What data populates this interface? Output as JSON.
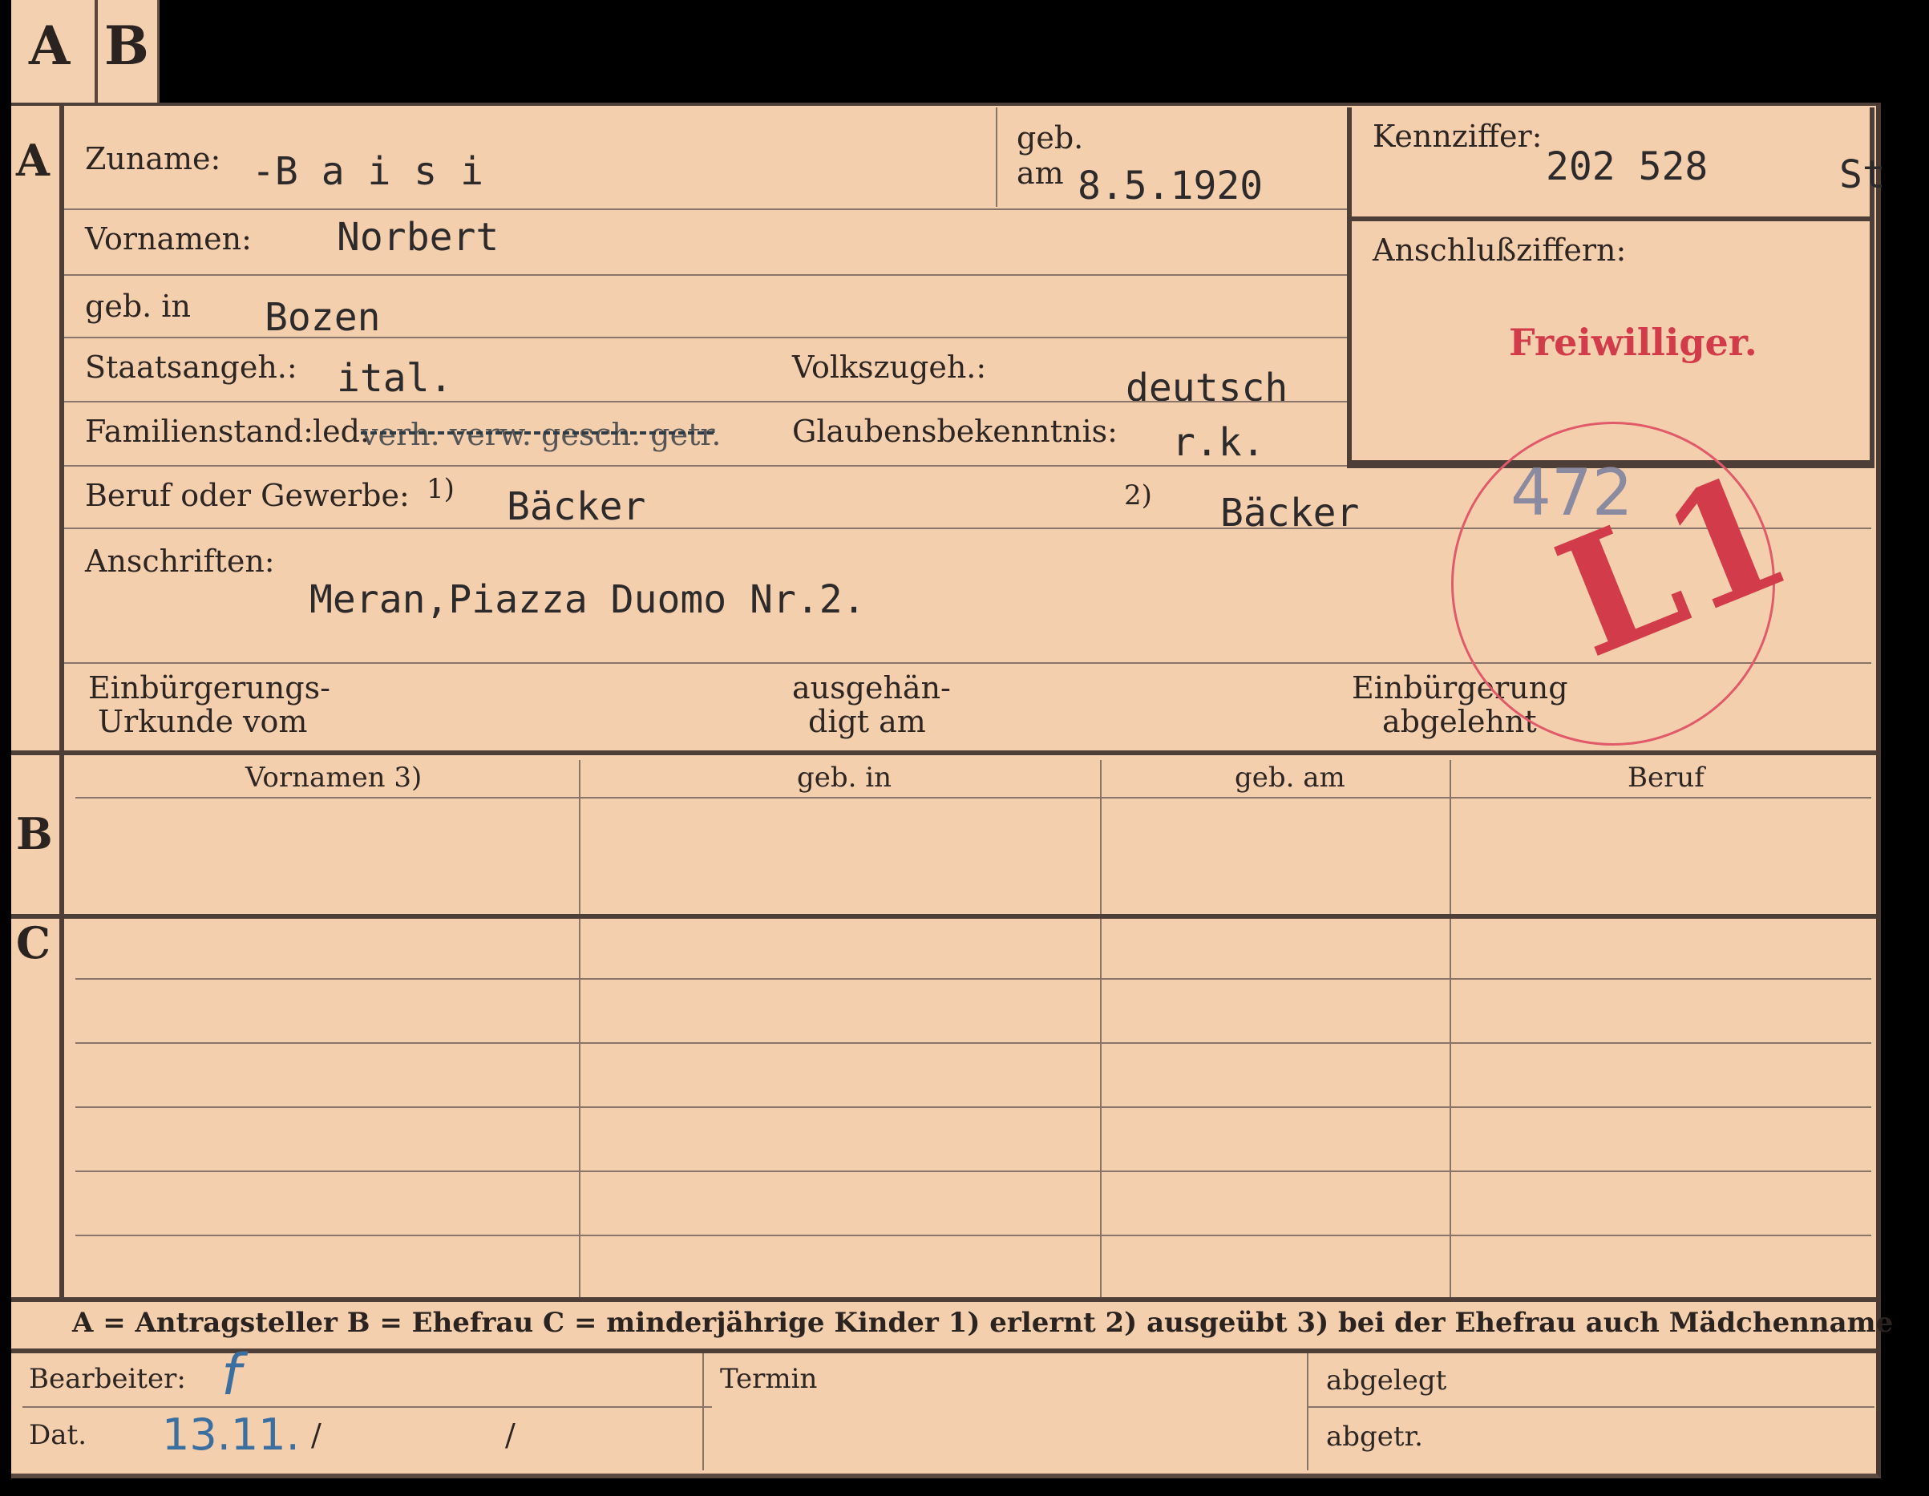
{
  "tabs": [
    "A",
    "B"
  ],
  "sections": {
    "a": "A",
    "b": "B",
    "c": "C"
  },
  "header": {
    "surname_label": "Zuname:",
    "surname": "-B a i s i",
    "born_label": "geb.",
    "born_on_label": "am",
    "birth_date": "8.5.1920",
    "id_label": "Kennziffer:",
    "id_value": "202 528",
    "id_suffix": "St",
    "connection_label": "Anschlußziffern:",
    "volunteer_stamp": "Freiwilliger."
  },
  "fields": {
    "first_names_label": "Vornamen:",
    "first_names": "Norbert",
    "birthplace_label": "geb. in",
    "birthplace": "Bozen",
    "citizenship_label": "Staatsangeh.:",
    "citizenship": "ital.",
    "ethnicity_label": "Volkszugeh.:",
    "ethnicity": "deutsch",
    "marital_label": "Familienstand:",
    "marital_value": "led.",
    "marital_struck": "verh. verw. gesch. getr.",
    "religion_label": "Glaubensbekenntnis:",
    "religion": "r.k.",
    "profession_label": "Beruf oder Gewerbe:",
    "profession_mark_1": "1)",
    "profession_1": "Bäcker",
    "profession_mark_2": "2)",
    "profession_2": "Bäcker",
    "address_label": "Anschriften:",
    "address": "Meran,Piazza  Duomo Nr.2.",
    "naturalization_label_1": "Einbürgerungs-",
    "naturalization_label_2": "Urkunde vom",
    "handed_label_1": "ausgehän-",
    "handed_label_2": "digt am",
    "rejected_label_1": "Einbürgerung",
    "rejected_label_2": "abgelehnt"
  },
  "stamp": {
    "handwritten_number": "472",
    "code": "L1",
    "color": "#d23c4a"
  },
  "table": {
    "headers": [
      "Vornamen 3)",
      "geb. in",
      "geb. am",
      "Beruf"
    ]
  },
  "legend": {
    "text": "A = Antragsteller   B = Ehefrau   C = minderjährige Kinder   1) erlernt   2) ausgeübt   3) bei der Ehefrau auch Mädchenname"
  },
  "footer": {
    "clerk_label": "Bearbeiter:",
    "clerk_initial": "f",
    "date_label": "Dat.",
    "date_value": "13.11.",
    "slash_1": "/",
    "slash_2": "/",
    "deadline_label": "Termin",
    "filed_label": "abgelegt",
    "delivered_label": "abgetr."
  }
}
